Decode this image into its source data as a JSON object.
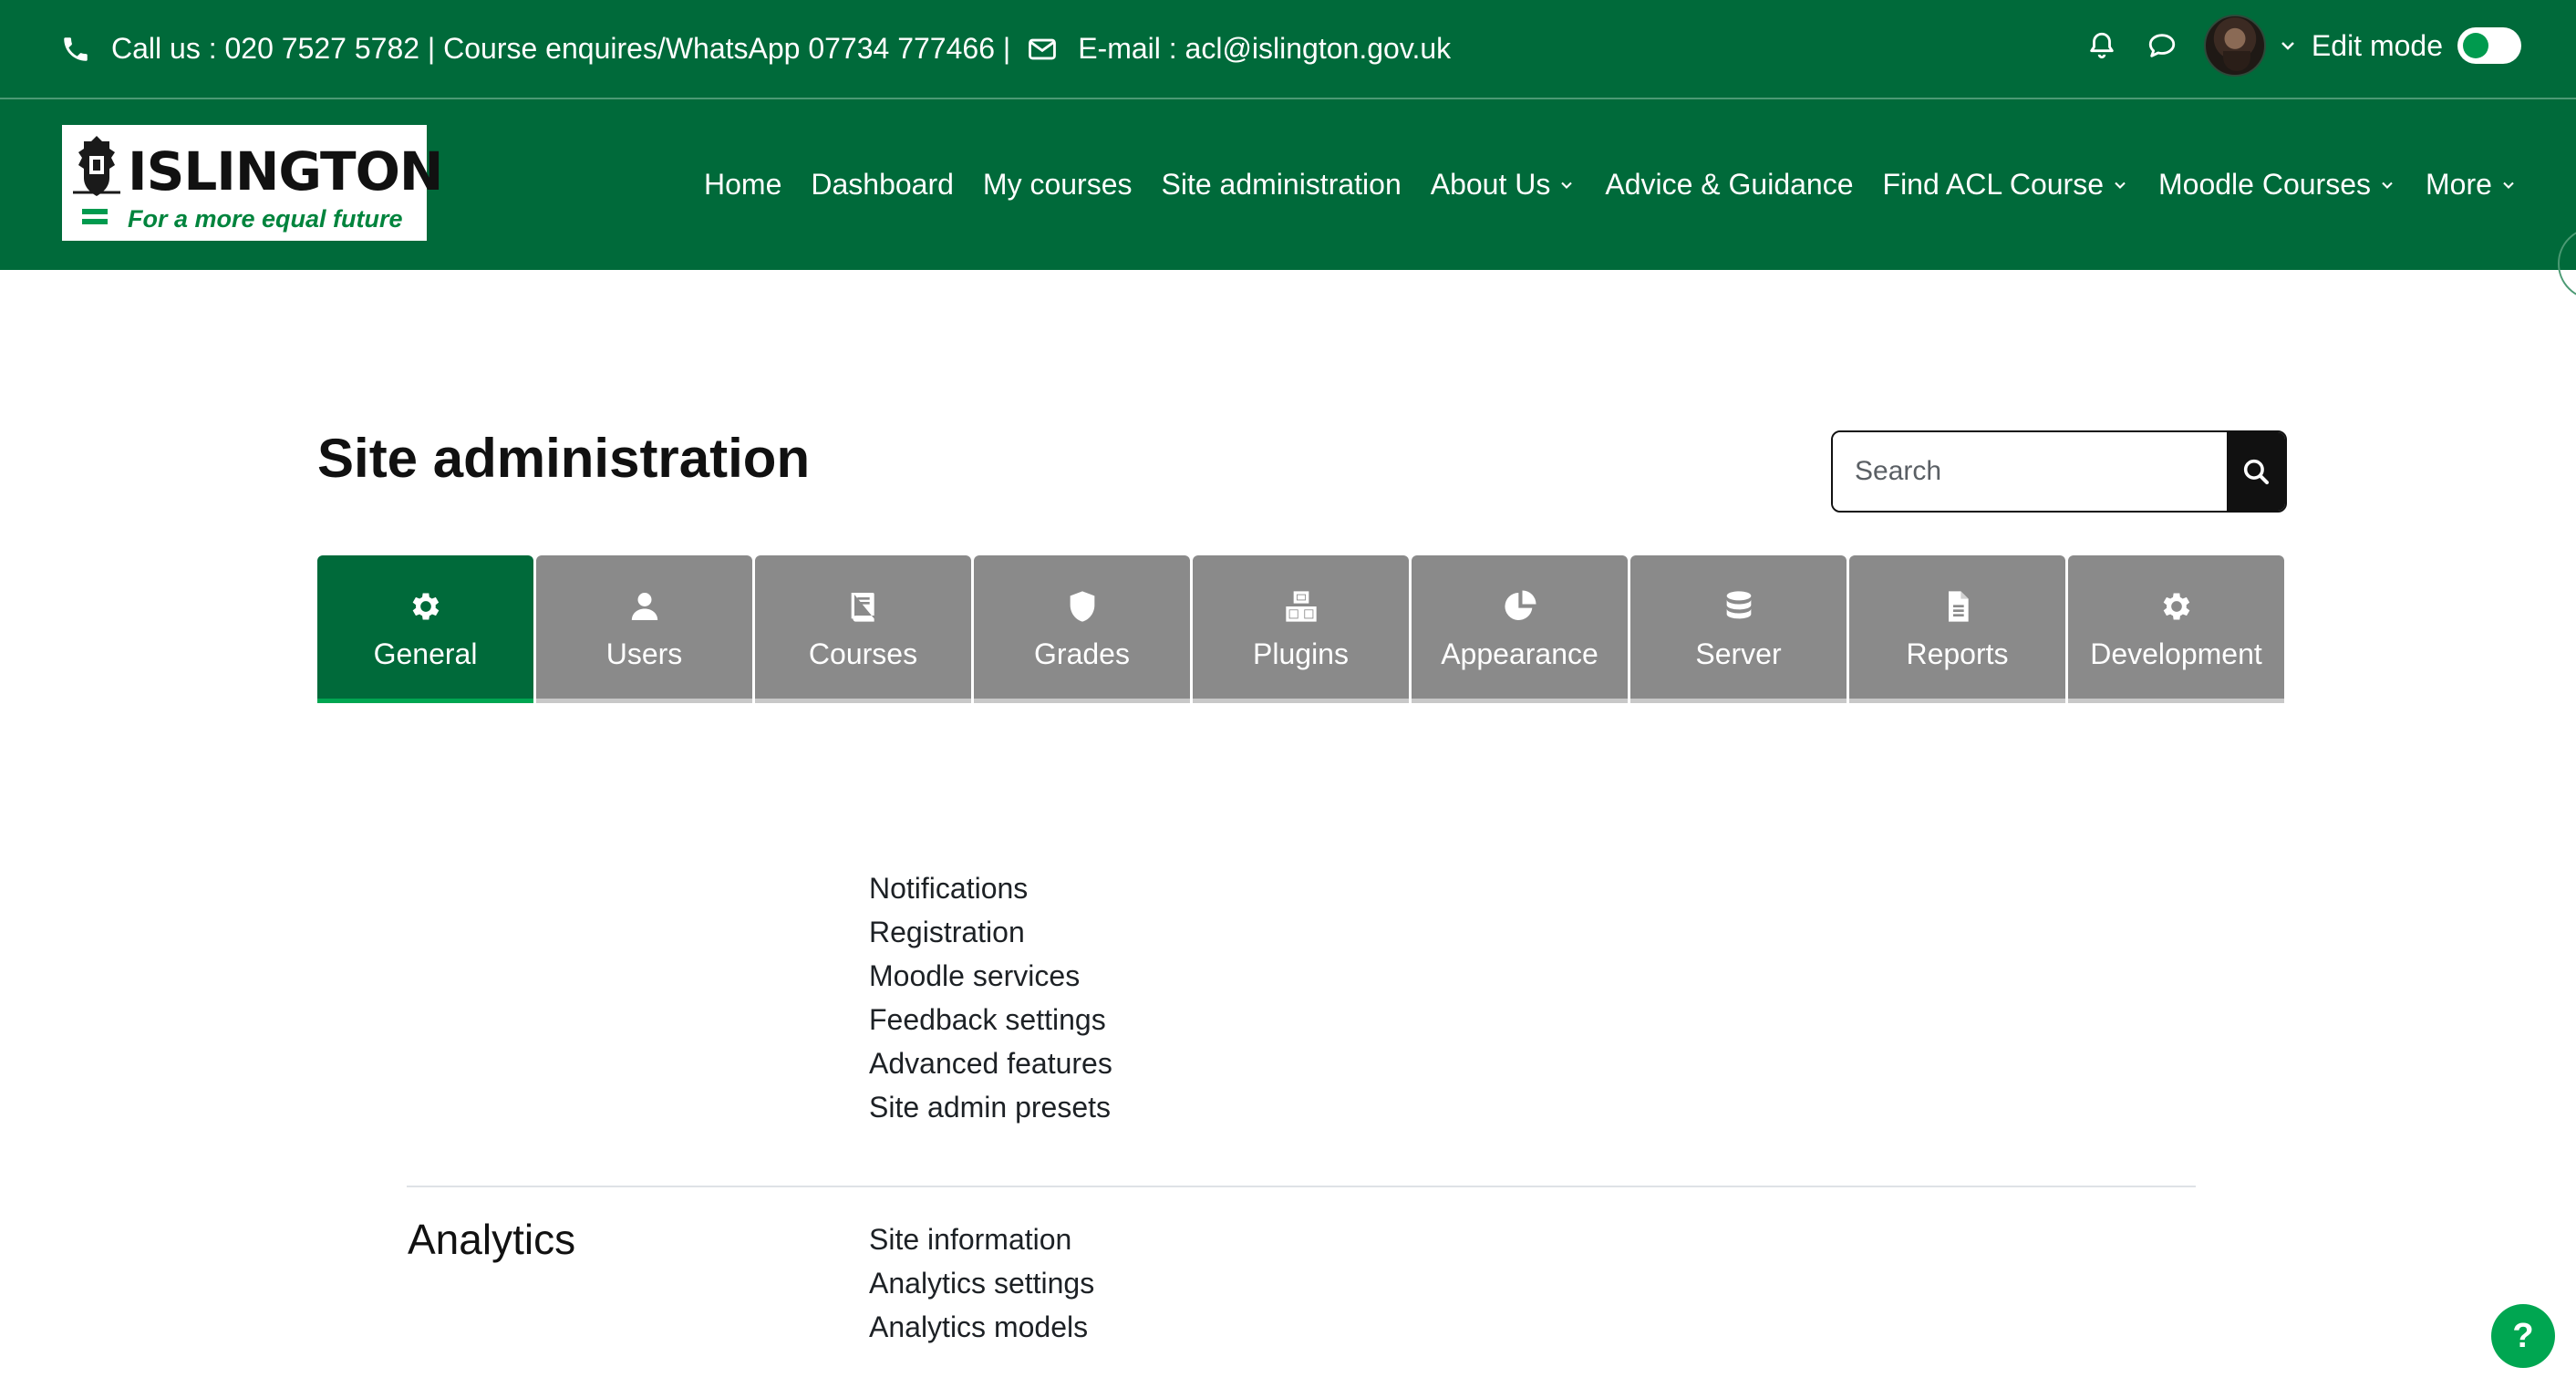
{
  "topbar": {
    "contact_text": "Call us : 020 7527 5782 | Course enquires/WhatsApp 07734 777466 |",
    "email_text": "E-mail : acl@islington.gov.uk",
    "phone_icon": "phone-icon",
    "email_icon": "envelope-icon",
    "edit_mode_label": "Edit mode",
    "edit_mode_on": true
  },
  "brand": {
    "wordmark": "ISLINGTON",
    "tagline": "For a more equal future",
    "accent_color": "#006a3a",
    "brand_green": "#00a651"
  },
  "nav": {
    "items": [
      {
        "label": "Home",
        "dropdown": false
      },
      {
        "label": "Dashboard",
        "dropdown": false
      },
      {
        "label": "My courses",
        "dropdown": false
      },
      {
        "label": "Site administration",
        "dropdown": false
      },
      {
        "label": "About Us",
        "dropdown": true
      },
      {
        "label": "Advice & Guidance",
        "dropdown": false
      },
      {
        "label": "Find ACL Course",
        "dropdown": true
      },
      {
        "label": "Moodle Courses",
        "dropdown": true
      },
      {
        "label": "More",
        "dropdown": true
      }
    ]
  },
  "page": {
    "title": "Site administration",
    "search_placeholder": "Search"
  },
  "tabs": [
    {
      "label": "General",
      "icon": "gear-icon",
      "active": true
    },
    {
      "label": "Users",
      "icon": "user-icon",
      "active": false
    },
    {
      "label": "Courses",
      "icon": "book-icon",
      "active": false
    },
    {
      "label": "Grades",
      "icon": "shield-icon",
      "active": false
    },
    {
      "label": "Plugins",
      "icon": "cubes-icon",
      "active": false
    },
    {
      "label": "Appearance",
      "icon": "pie-chart-icon",
      "active": false
    },
    {
      "label": "Server",
      "icon": "database-icon",
      "active": false
    },
    {
      "label": "Reports",
      "icon": "file-icon",
      "active": false
    },
    {
      "label": "Development",
      "icon": "gear-icon",
      "active": false
    }
  ],
  "general": {
    "links": [
      "Notifications",
      "Registration",
      "Moodle services",
      "Feedback settings",
      "Advanced features",
      "Site admin presets"
    ]
  },
  "analytics": {
    "title": "Analytics",
    "links": [
      "Site information",
      "Analytics settings",
      "Analytics models"
    ]
  },
  "help": {
    "label": "?"
  }
}
